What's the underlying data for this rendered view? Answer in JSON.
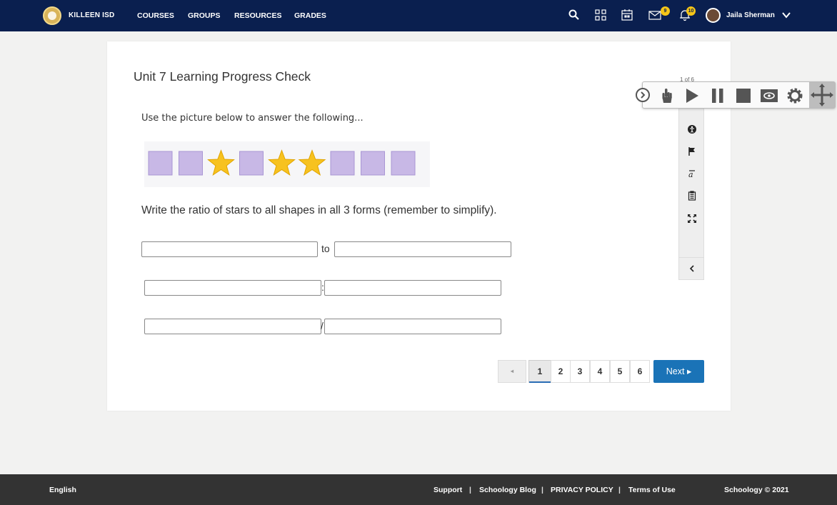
{
  "nav": {
    "brand": "KILLEEN ISD",
    "links": [
      "COURSES",
      "GROUPS",
      "RESOURCES",
      "GRADES"
    ],
    "messages_badge": "9",
    "notifications_badge": "10",
    "user_name": "Jaila Sherman"
  },
  "assessment": {
    "title": "Unit 7 Learning Progress Check",
    "prompt": "Use the picture below to answer the following...",
    "shapes": [
      "square",
      "square",
      "star",
      "square",
      "star",
      "star",
      "square",
      "square",
      "square"
    ],
    "question": "Write the ratio of stars to all shapes in all 3 forms (remember to simplify).",
    "form1_separator": "to",
    "form2_separator": ":",
    "form3_separator": "/",
    "inputs": [
      "",
      "",
      "",
      "",
      "",
      ""
    ]
  },
  "pagination": {
    "prev": "◂",
    "pages": [
      "1",
      "2",
      "3",
      "4",
      "5",
      "6"
    ],
    "current": "1",
    "next": "Next ▸",
    "counter": "1 of 6"
  },
  "colors": {
    "nav_bg": "#0a1f4f",
    "accent": "#1a73b7",
    "square": "#c8b8e6",
    "star": "#f7c21f"
  },
  "footer": {
    "language": "English",
    "links": [
      "Support",
      "Schoology Blog",
      "PRIVACY POLICY",
      "Terms of Use"
    ],
    "separator": "|",
    "copyright": "Schoology © 2021"
  }
}
